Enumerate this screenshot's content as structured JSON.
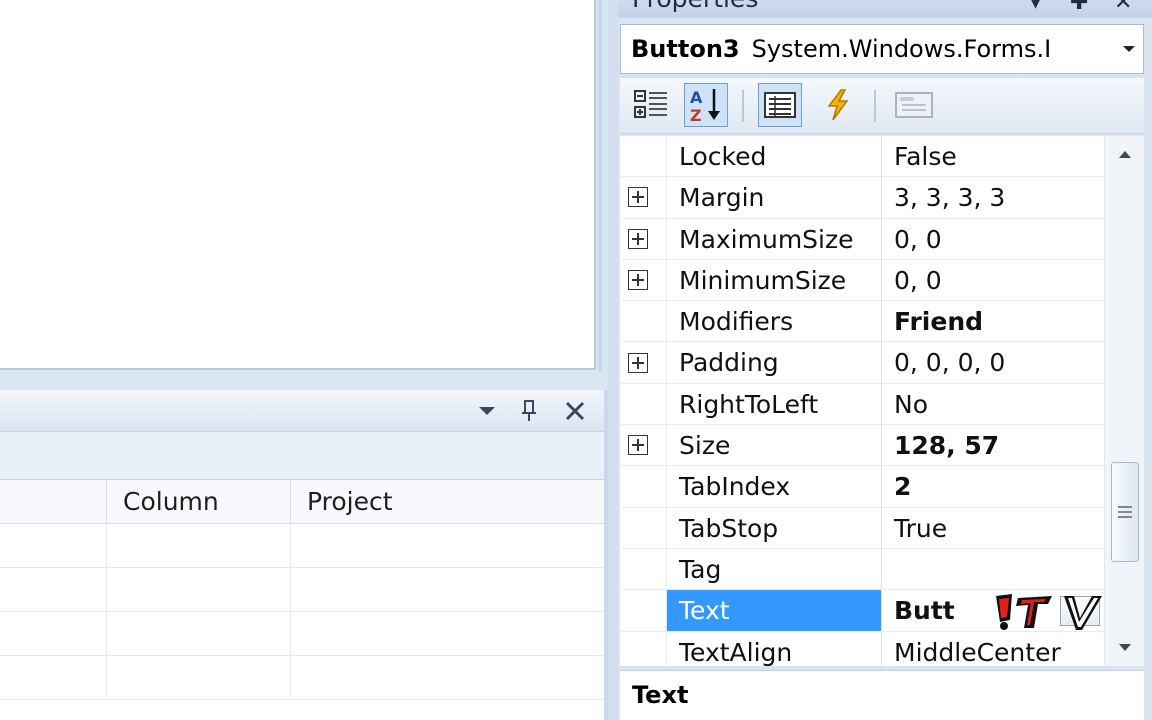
{
  "properties_window": {
    "title": "Properties",
    "selected_object": {
      "name": "Button3",
      "type": "System.Windows.Forms.I"
    },
    "toolbar": {
      "categorized": "categorized-icon",
      "alphabetical": "sort-az-icon",
      "properties": "properties-list-icon",
      "events": "lightning-events-icon",
      "property_pages": "property-pages-icon"
    },
    "rows": [
      {
        "name": "Locked",
        "value": "False",
        "expandable": false,
        "bold": false
      },
      {
        "name": "Margin",
        "value": "3, 3, 3, 3",
        "expandable": true,
        "bold": false
      },
      {
        "name": "MaximumSize",
        "value": "0, 0",
        "expandable": true,
        "bold": false
      },
      {
        "name": "MinimumSize",
        "value": "0, 0",
        "expandable": true,
        "bold": false
      },
      {
        "name": "Modifiers",
        "value": "Friend",
        "expandable": false,
        "bold": true
      },
      {
        "name": "Padding",
        "value": "0, 0, 0, 0",
        "expandable": true,
        "bold": false
      },
      {
        "name": "RightToLeft",
        "value": "No",
        "expandable": false,
        "bold": false
      },
      {
        "name": "Size",
        "value": "128, 57",
        "expandable": true,
        "bold": true
      },
      {
        "name": "TabIndex",
        "value": "2",
        "expandable": false,
        "bold": true
      },
      {
        "name": "TabStop",
        "value": "True",
        "expandable": false,
        "bold": false
      },
      {
        "name": "Tag",
        "value": "",
        "expandable": false,
        "bold": false
      },
      {
        "name": "Text",
        "value": "Butt",
        "expandable": false,
        "bold": true,
        "selected": true
      },
      {
        "name": "TextAlign",
        "value": "MiddleCenter",
        "expandable": false,
        "bold": false
      }
    ],
    "description_title": "Text"
  },
  "error_list": {
    "columns": [
      "Column",
      "Project"
    ]
  },
  "colors": {
    "selection": "#3399ff",
    "chrome": "#dae4f1"
  }
}
